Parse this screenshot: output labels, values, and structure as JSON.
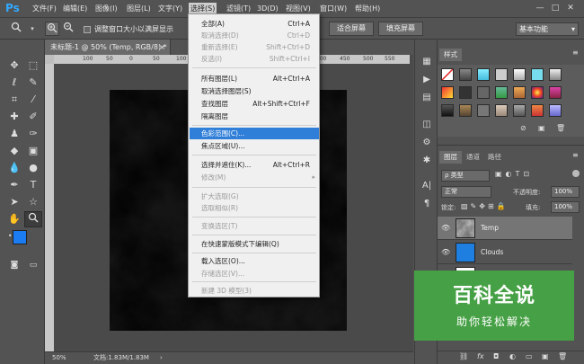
{
  "app": {
    "logo": "Ps"
  },
  "menubar": {
    "items": [
      "文件(F)",
      "编辑(E)",
      "图像(I)",
      "图层(L)",
      "文字(Y)",
      "选择(S)",
      "滤镜(T)",
      "3D(D)",
      "视图(V)",
      "窗口(W)",
      "帮助(H)"
    ],
    "active_index": 5,
    "window_controls": [
      "—",
      "□",
      "✕"
    ]
  },
  "options_bar": {
    "resize_windows_label": "调整窗口大小以满屏显示",
    "fill_screen_label": "适合屏幕",
    "fill_screen2_label": "填充屏幕",
    "workspace_label": "基本功能"
  },
  "document": {
    "tab_title": "未标题-1 @ 50% (Temp, RGB/8) *",
    "zoom": "50%",
    "doc_info": "文档:1.83M/1.83M",
    "ruler_ticks": [
      "100",
      "50",
      "0",
      "50",
      "100",
      "150",
      "200",
      "250",
      "300",
      "350",
      "400",
      "450",
      "500",
      "550",
      "600"
    ]
  },
  "select_menu": {
    "items": [
      {
        "label": "全部(A)",
        "shortcut": "Ctrl+A",
        "disabled": false
      },
      {
        "label": "取消选择(D)",
        "shortcut": "Ctrl+D",
        "disabled": true
      },
      {
        "label": "重新选择(E)",
        "shortcut": "Shift+Ctrl+D",
        "disabled": true
      },
      {
        "label": "反选(I)",
        "shortcut": "Shift+Ctrl+I",
        "disabled": true
      },
      {
        "label": "所有图层(L)",
        "shortcut": "Alt+Ctrl+A",
        "disabled": false
      },
      {
        "label": "取消选择图层(S)",
        "shortcut": "",
        "disabled": false
      },
      {
        "label": "查找图层",
        "shortcut": "Alt+Shift+Ctrl+F",
        "disabled": false
      },
      {
        "label": "隔离图层",
        "shortcut": "",
        "disabled": false
      },
      {
        "label": "色彩范围(C)...",
        "shortcut": "",
        "disabled": false,
        "highlighted": true
      },
      {
        "label": "焦点区域(U)...",
        "shortcut": "",
        "disabled": false
      },
      {
        "label": "选择并遮住(K)...",
        "shortcut": "Alt+Ctrl+R",
        "disabled": false
      },
      {
        "label": "修改(M)",
        "shortcut": "",
        "disabled": true,
        "submenu": true
      },
      {
        "label": "扩大选取(G)",
        "shortcut": "",
        "disabled": true
      },
      {
        "label": "选取相似(R)",
        "shortcut": "",
        "disabled": true
      },
      {
        "label": "变换选区(T)",
        "shortcut": "",
        "disabled": true
      },
      {
        "label": "在快速蒙版模式下编辑(Q)",
        "shortcut": "",
        "disabled": false
      },
      {
        "label": "载入选区(O)...",
        "shortcut": "",
        "disabled": false
      },
      {
        "label": "存储选区(V)...",
        "shortcut": "",
        "disabled": true
      },
      {
        "label": "新建 3D 模型(3)",
        "shortcut": "",
        "disabled": true
      }
    ]
  },
  "styles_panel": {
    "tab_label": "样式"
  },
  "layers_panel": {
    "tabs": [
      "图层",
      "通道",
      "路径"
    ],
    "filter_label": "ρ 类型",
    "blend_mode": "正常",
    "opacity_label": "不透明度:",
    "opacity_value": "100%",
    "lock_label": "锁定:",
    "fill_label": "填充:",
    "fill_value": "100%",
    "layers": [
      {
        "name": "Temp",
        "color": "#6b6b6b",
        "selected": true
      },
      {
        "name": "Clouds",
        "color": "#1f7fe0",
        "selected": false
      },
      {
        "name": "",
        "color": "#ffffff",
        "selected": false
      }
    ],
    "footer_icons": [
      "link-icon",
      "fx-icon",
      "mask-icon",
      "adjustment-icon",
      "folder-icon",
      "new-layer-icon",
      "trash-icon"
    ]
  },
  "colors": {
    "foreground": "#1a7cf0",
    "background": "#ffffff",
    "menu_highlight": "#2f7ed8"
  },
  "watermark": {
    "title": "百科全说",
    "subtitle": "助你轻松解决"
  }
}
